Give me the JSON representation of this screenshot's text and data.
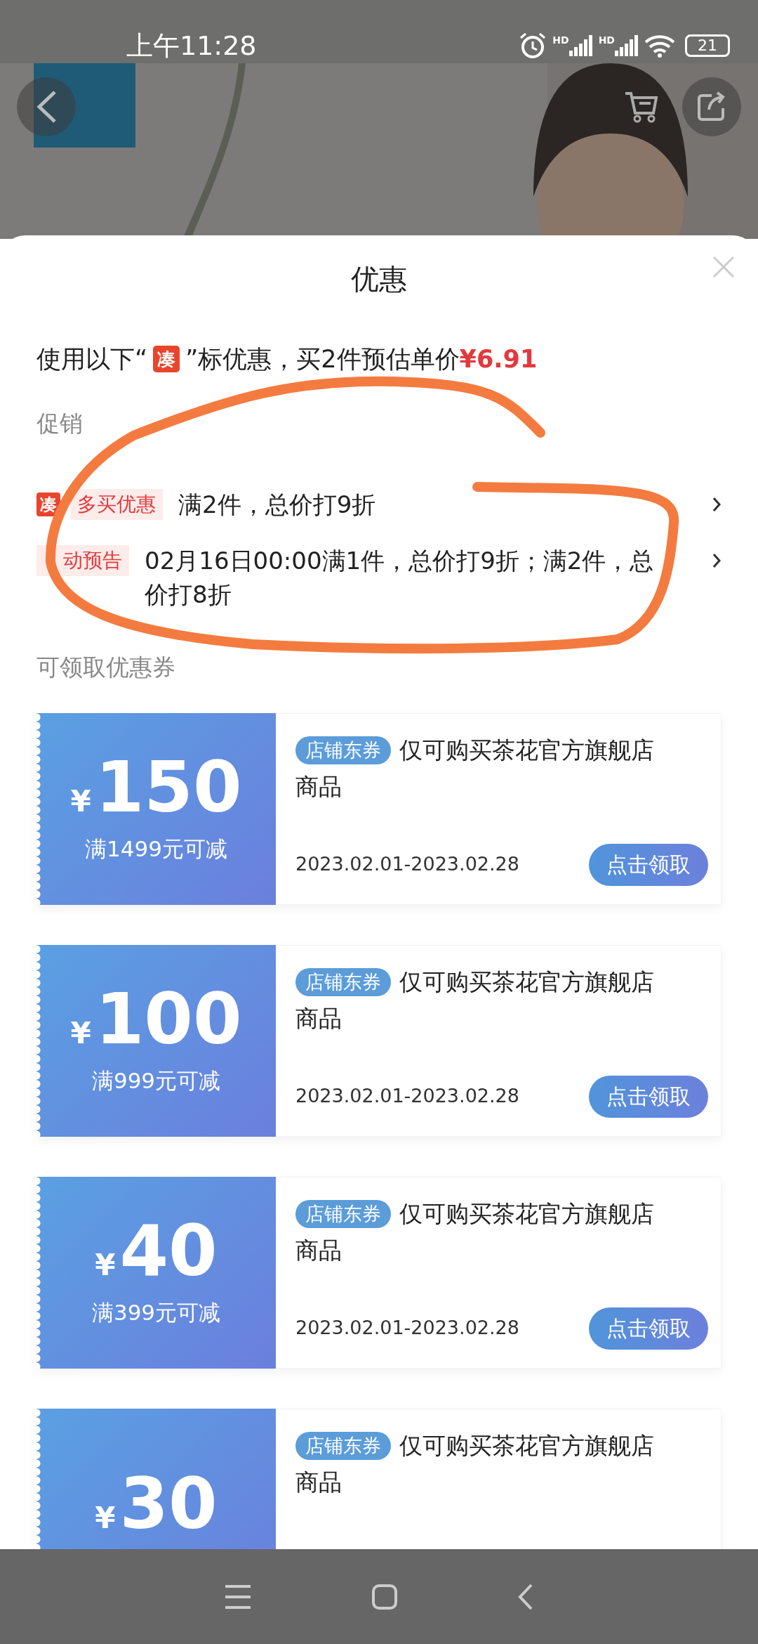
{
  "status_bar": {
    "time": "上午11:28",
    "signal_labels": [
      "HD",
      "HD"
    ],
    "battery": "21"
  },
  "sheet": {
    "title": "优惠",
    "summary": {
      "before": "使用以下“",
      "tag": "凑",
      "after": "”标优惠，买2件预估单价",
      "price": "¥6.91"
    },
    "promotions_label": "促销",
    "promotions": [
      {
        "icon": "凑",
        "tag": "多买优惠",
        "text": "满2件，总价打9折"
      },
      {
        "tag": "动预告",
        "text": "02月16日00:00满1件，总价打9折；满2件，总价打8折"
      }
    ],
    "coupons_label": "可领取优惠券",
    "coupons": [
      {
        "currency": "¥",
        "amount": "150",
        "condition": "满1499元可减",
        "tag": "店铺东券",
        "description": "仅可购买茶花官方旗舰店商品",
        "dates": "2023.02.01-2023.02.28",
        "button": "点击领取"
      },
      {
        "currency": "¥",
        "amount": "100",
        "condition": "满999元可减",
        "tag": "店铺东券",
        "description": "仅可购买茶花官方旗舰店商品",
        "dates": "2023.02.01-2023.02.28",
        "button": "点击领取"
      },
      {
        "currency": "¥",
        "amount": "40",
        "condition": "满399元可减",
        "tag": "店铺东券",
        "description": "仅可购买茶花官方旗舰店商品",
        "dates": "2023.02.01-2023.02.28",
        "button": "点击领取"
      },
      {
        "currency": "¥",
        "amount": "30",
        "tag": "店铺东券",
        "description": "仅可购买茶花官方旗舰店商品"
      }
    ]
  }
}
